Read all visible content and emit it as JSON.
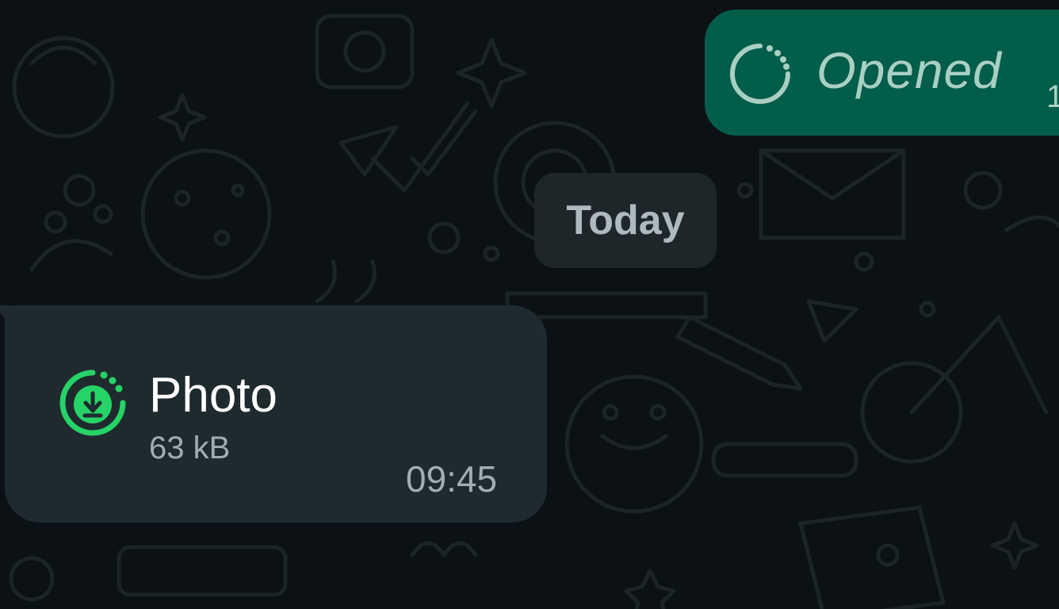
{
  "colors": {
    "background": "#0b1114",
    "outgoing_bubble": "#025e4a",
    "incoming_bubble": "#1f2a2e",
    "date_pill": "#1d2629",
    "accent_green": "#25d366"
  },
  "outgoing_message": {
    "status_icon": "view-once-opened-icon",
    "text": "Opened",
    "time_partial": "1"
  },
  "date_separator": {
    "label": "Today"
  },
  "incoming_message": {
    "icon": "download-icon",
    "title": "Photo",
    "size": "63 kB",
    "time": "09:45"
  }
}
